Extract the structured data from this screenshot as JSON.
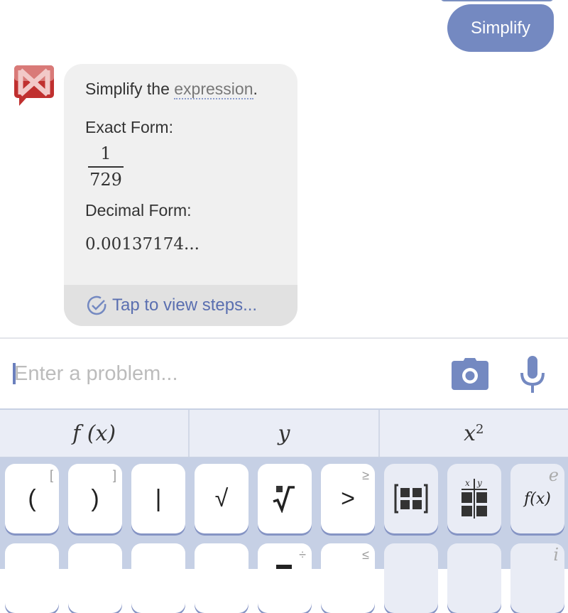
{
  "chat": {
    "user_message": "Simplify",
    "bot": {
      "intro_prefix": "Simplify the ",
      "intro_link": "expression",
      "intro_suffix": ".",
      "exact_label": "Exact Form:",
      "exact_numerator": "1",
      "exact_denominator": "729",
      "decimal_label": "Decimal Form:",
      "decimal_value": "0.00137174...",
      "steps_label": "Tap to view steps..."
    }
  },
  "input": {
    "placeholder": "Enter a problem...",
    "value": ""
  },
  "colors": {
    "accent": "#7489c1",
    "logo_red": "#c0302f",
    "link": "#5a6fb0"
  },
  "tabs": [
    {
      "label": "f (x)"
    },
    {
      "label": "y"
    },
    {
      "label": "x",
      "sup": "2"
    }
  ],
  "keys_row1": [
    {
      "label": "(",
      "corner": "["
    },
    {
      "label": ")",
      "corner": "]"
    },
    {
      "label": "|",
      "corner": ""
    },
    {
      "label": "√",
      "corner": ""
    },
    {
      "label": "∛",
      "corner": ""
    },
    {
      "label": ">",
      "corner": "≥"
    },
    {
      "label": "matrix",
      "corner": ""
    },
    {
      "label": "table",
      "corner": ""
    },
    {
      "label": "f(x)",
      "corner": "e"
    }
  ],
  "keys_row2": [
    {
      "label": "",
      "corner": ""
    },
    {
      "label": "",
      "corner": ""
    },
    {
      "label": "",
      "corner": ""
    },
    {
      "label": "",
      "corner": ""
    },
    {
      "label": "",
      "corner": "÷"
    },
    {
      "label": "",
      "corner": "≤"
    },
    {
      "label": "",
      "corner": ""
    },
    {
      "label": "",
      "corner": ""
    },
    {
      "label": "",
      "corner": "i"
    }
  ]
}
